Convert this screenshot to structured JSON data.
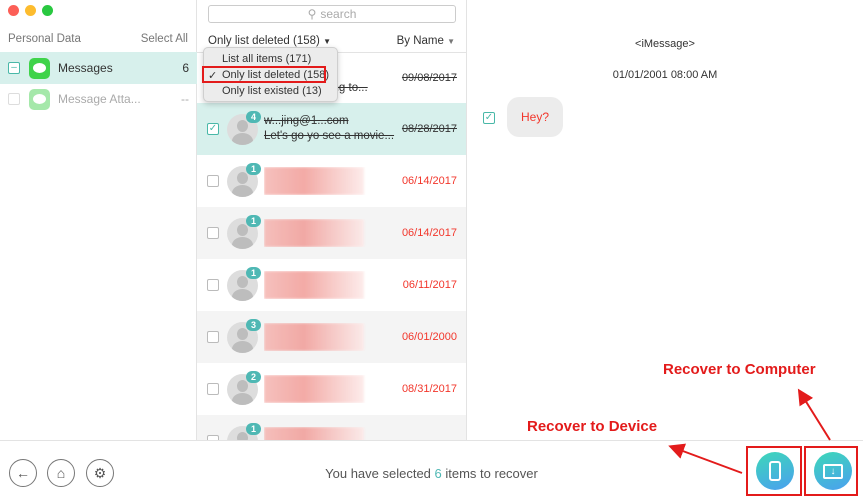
{
  "sidebar": {
    "header": "Personal Data",
    "select_all": "Select All",
    "items": [
      {
        "label": "Messages",
        "count": "6",
        "state": "partial"
      },
      {
        "label": "Message Atta...",
        "count": "--",
        "state": "unchecked"
      }
    ]
  },
  "list": {
    "search_placeholder": "search",
    "filter_label": "Only list deleted (158)",
    "sort_label": "By Name",
    "filter_menu": [
      {
        "label": "List all items (171)"
      },
      {
        "label": "Only list deleted (158)",
        "checked": true,
        "check": "✓"
      },
      {
        "label": "Only list existed (13)"
      }
    ],
    "rows": [
      {
        "line2": "...oing to...",
        "date": "09/08/2017",
        "deleted": true
      },
      {
        "badge": "4",
        "line1": "w...jing@1...com",
        "line2": "Let's go yo see a movie...",
        "date": "08/28/2017",
        "checked": true,
        "deleted": true
      },
      {
        "badge": "1",
        "date": "06/14/2017"
      },
      {
        "badge": "1",
        "date": "06/14/2017"
      },
      {
        "badge": "1",
        "date": "06/11/2017"
      },
      {
        "badge": "3",
        "date": "06/01/2000"
      },
      {
        "badge": "2",
        "date": "08/31/2017"
      },
      {
        "badge": "1",
        "date": ""
      }
    ]
  },
  "detail": {
    "title": "<iMessage>",
    "timestamp": "01/01/2001 08:00 AM",
    "message": "Hey?"
  },
  "bottom": {
    "status_prefix": "You have selected ",
    "status_count": "6",
    "status_suffix": " items to recover"
  },
  "annotations": {
    "recover_device": "Recover to Device",
    "recover_computer": "Recover to Computer"
  },
  "colors": {
    "accent": "#4fb8b4",
    "deleted": "#f2362b",
    "highlight": "#e31b1b"
  }
}
